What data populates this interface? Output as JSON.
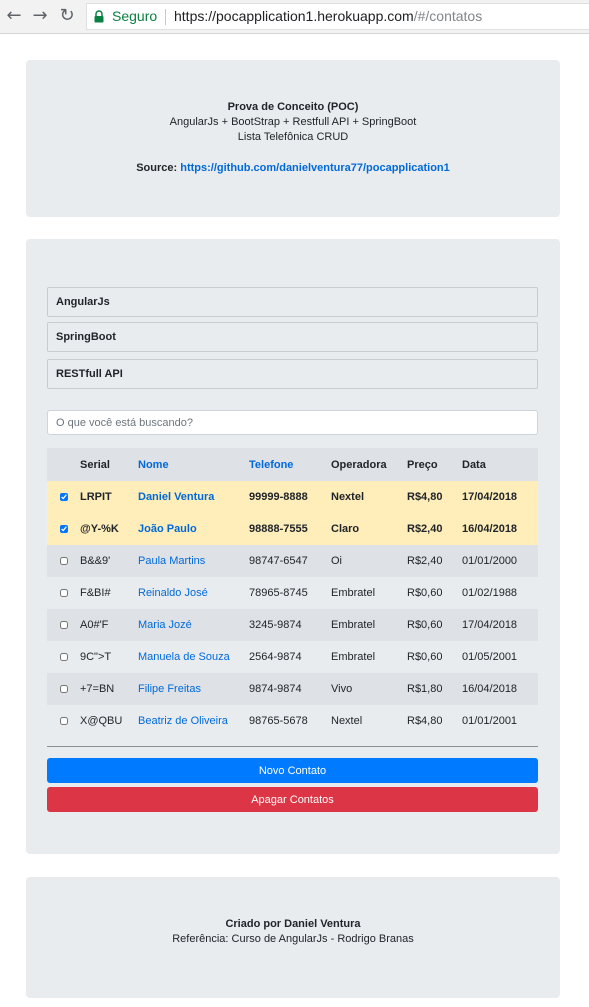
{
  "browser": {
    "back": "←",
    "forward": "→",
    "reload": "↻",
    "secure_label": "Seguro",
    "url_host": "https://pocapplication1.herokuapp.com",
    "url_path": "/#/contatos"
  },
  "header": {
    "title": "Prova de Conceito (POC)",
    "stack": "AngularJs + BootStrap + Restfull API + SpringBoot",
    "subtitle": "Lista Telefônica CRUD",
    "source_label": "Source:",
    "source_link": "https://github.com/danielventura77/pocapplication1"
  },
  "accordion": [
    "AngularJs",
    "SpringBoot",
    "RESTfull API"
  ],
  "search": {
    "placeholder": "O que você está buscando?"
  },
  "table": {
    "headers": [
      "Serial",
      "Nome",
      "Telefone",
      "Operadora",
      "Preço",
      "Data"
    ],
    "rows": [
      {
        "selected": true,
        "serial": "LRPIT",
        "name": "Daniel Ventura",
        "phone": "99999-8888",
        "carrier": "Nextel",
        "price": "R$4,80",
        "date": "17/04/2018"
      },
      {
        "selected": true,
        "serial": "@Y-%K",
        "name": "João Paulo",
        "phone": "98888-7555",
        "carrier": "Claro",
        "price": "R$2,40",
        "date": "16/04/2018"
      },
      {
        "selected": false,
        "serial": "B&&9'",
        "name": "Paula Martins",
        "phone": "98747-6547",
        "carrier": "Oi",
        "price": "R$2,40",
        "date": "01/01/2000"
      },
      {
        "selected": false,
        "serial": "F&BI#",
        "name": "Reinaldo José",
        "phone": "78965-8745",
        "carrier": "Embratel",
        "price": "R$0,60",
        "date": "01/02/1988"
      },
      {
        "selected": false,
        "serial": "A0#'F",
        "name": "Maria Jozé",
        "phone": "3245-9874",
        "carrier": "Embratel",
        "price": "R$0,60",
        "date": "17/04/2018"
      },
      {
        "selected": false,
        "serial": "9C\">T",
        "name": "Manuela de Souza",
        "phone": "2564-9874",
        "carrier": "Embratel",
        "price": "R$0,60",
        "date": "01/05/2001"
      },
      {
        "selected": false,
        "serial": "+7=BN",
        "name": "Filipe Freitas",
        "phone": "9874-9874",
        "carrier": "Vivo",
        "price": "R$1,80",
        "date": "16/04/2018"
      },
      {
        "selected": false,
        "serial": "X@QBU",
        "name": "Beatriz de Oliveira",
        "phone": "98765-5678",
        "carrier": "Nextel",
        "price": "R$4,80",
        "date": "01/01/2001"
      }
    ]
  },
  "buttons": {
    "new_contact": "Novo Contato",
    "delete_contacts": "Apagar Contatos"
  },
  "footer": {
    "created_by": "Criado por Daniel Ventura",
    "reference": "Referência: Curso de AngularJs - Rodrigo Branas"
  },
  "colors": {
    "primary": "#007bff",
    "danger": "#dc3545",
    "selected_row": "#ffeeba",
    "link": "#0069d9",
    "jumbotron": "#e9ecef",
    "secure_green": "#0b8043"
  }
}
